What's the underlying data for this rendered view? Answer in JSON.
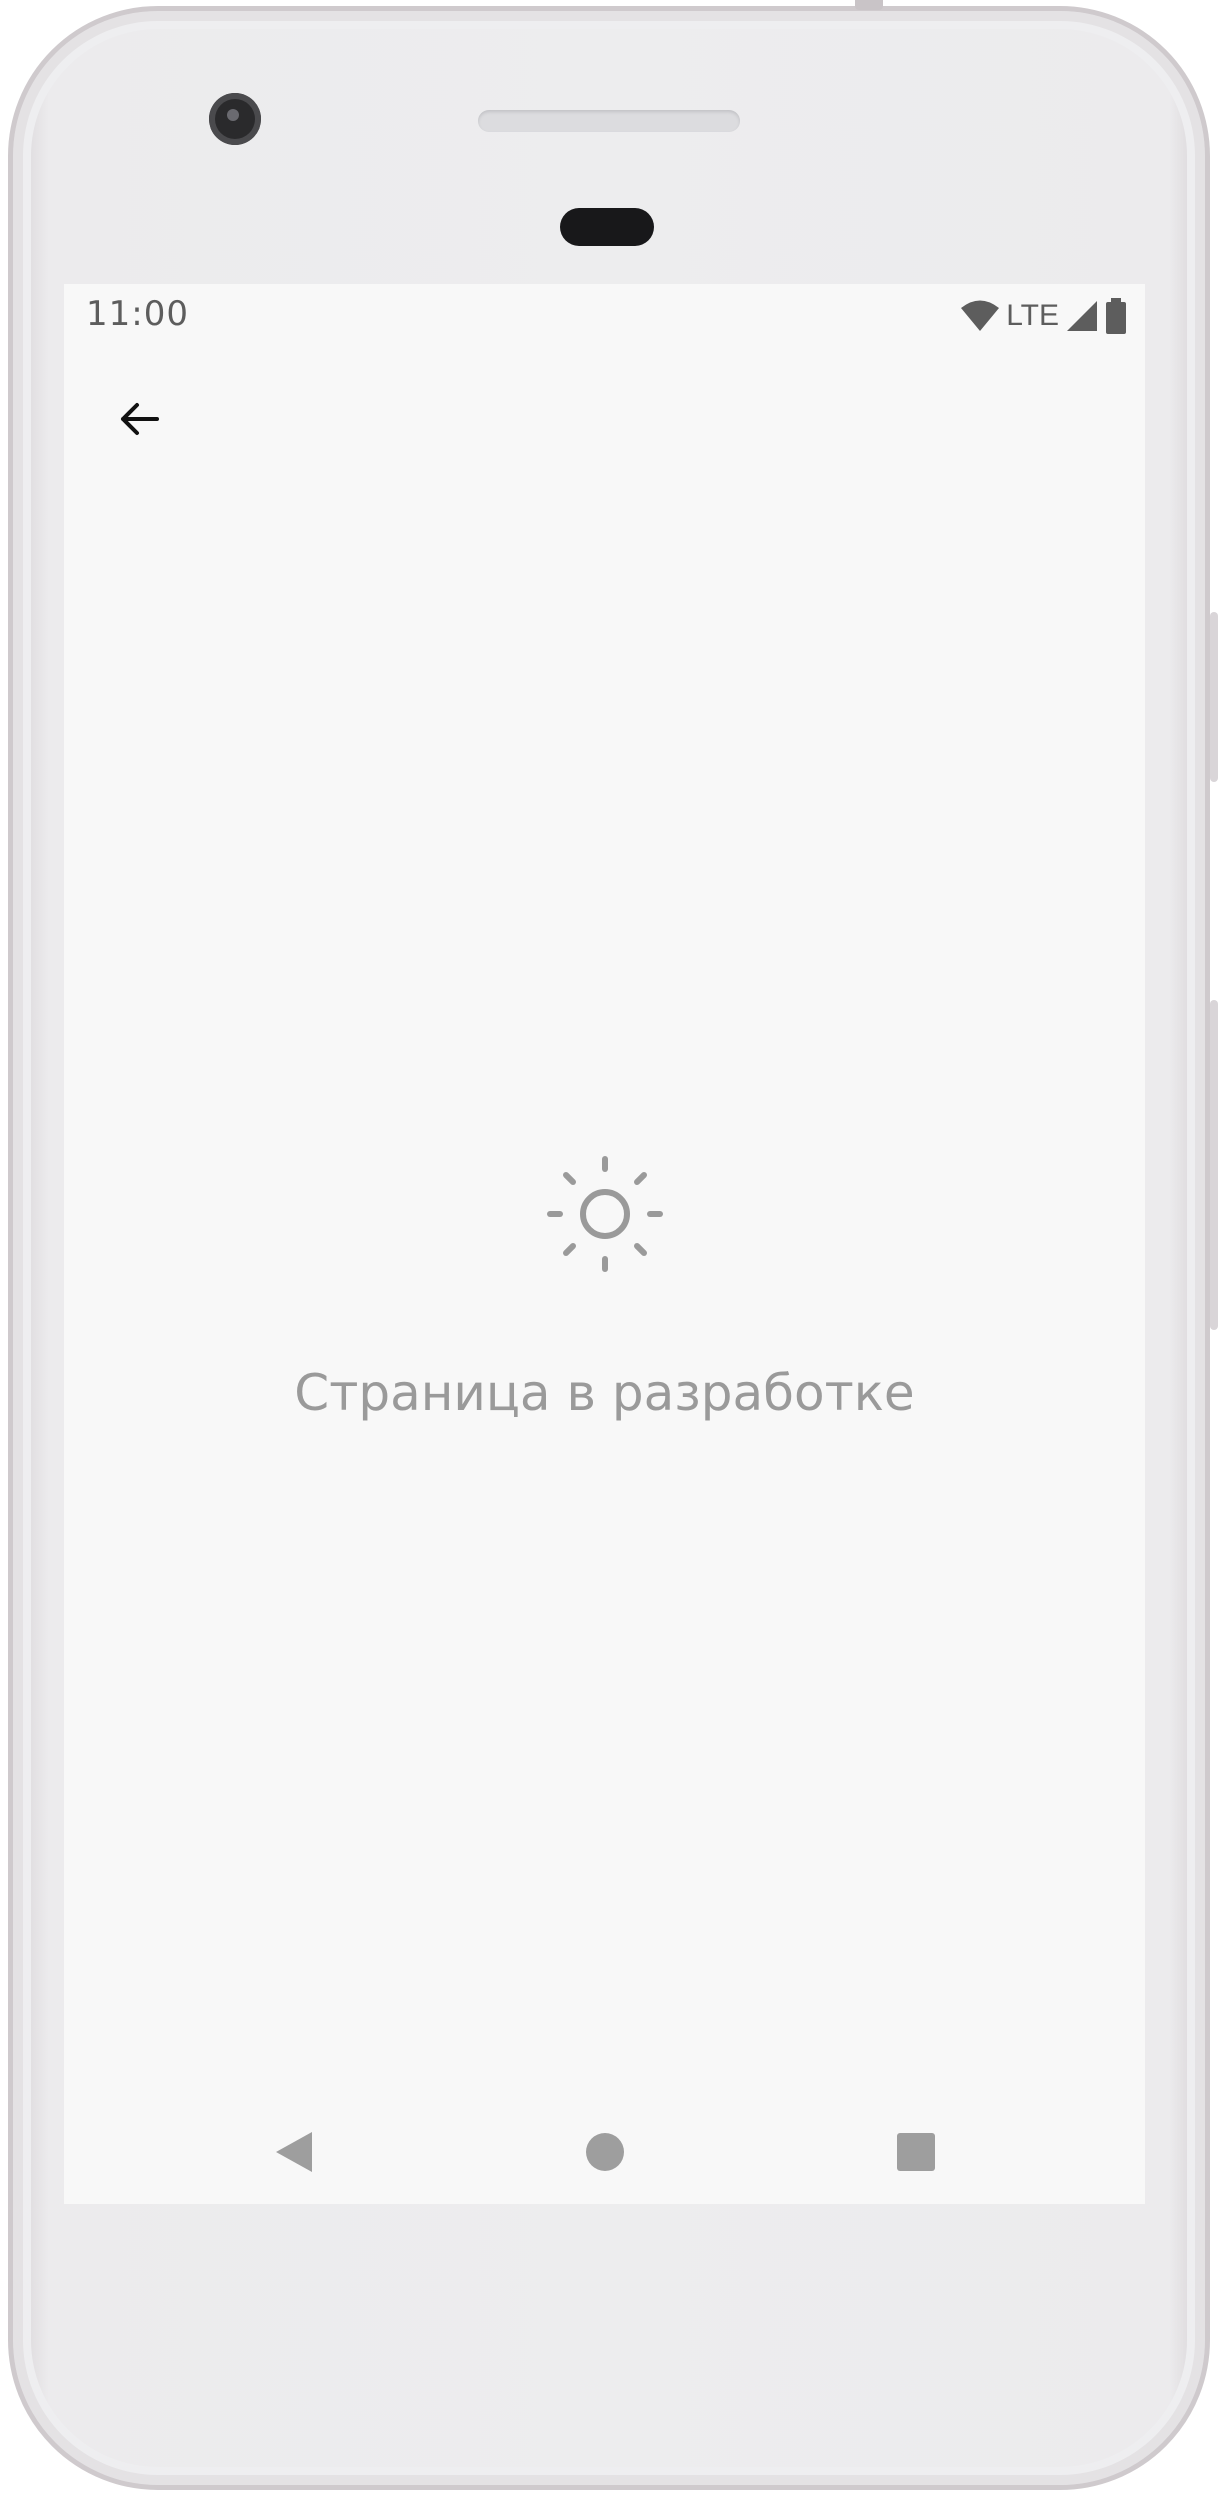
{
  "status_bar": {
    "time": "11:00",
    "network": "LTE",
    "icons": [
      "wifi-icon",
      "lte-label",
      "signal-icon",
      "battery-icon"
    ]
  },
  "toolbar": {
    "back_icon": "arrow-back-icon"
  },
  "content": {
    "icon": "brightness-icon",
    "message": "Страница в разработке"
  },
  "nav_bar": {
    "buttons": [
      "nav-back-icon",
      "nav-home-icon",
      "nav-recents-icon"
    ]
  },
  "colors": {
    "screen_background": "#f8f8f8",
    "muted_text": "#9a9a9a",
    "status_text": "#5d5d5d",
    "nav_icons": "#9e9e9e"
  }
}
